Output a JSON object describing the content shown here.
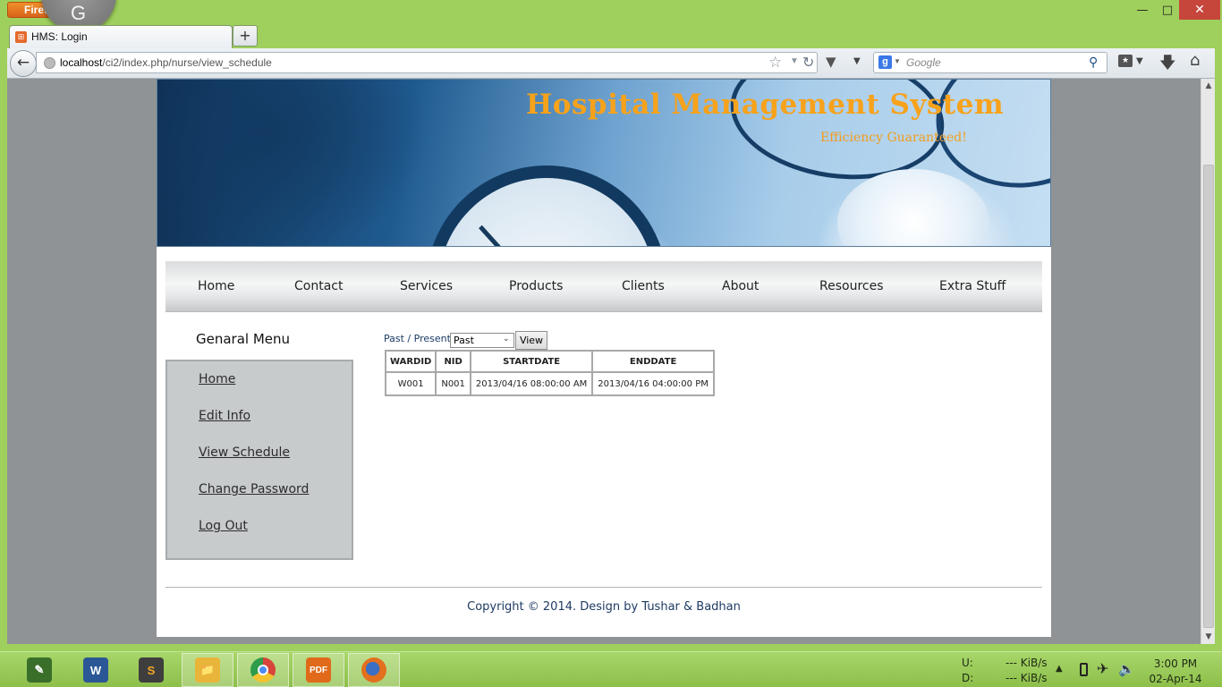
{
  "browser": {
    "menu_label": "Firefox",
    "tab_title": "HMS: Login",
    "url_host": "localhost",
    "url_path": "/ci2/index.php/nurse/view_schedule",
    "search_placeholder": "Google",
    "new_tab_label": "+"
  },
  "site": {
    "title": "Hospital Management System",
    "tagline": "Efficiency Guaranteed!"
  },
  "nav": {
    "items": [
      "Home",
      "Contact",
      "Services",
      "Products",
      "Clients",
      "About",
      "Resources",
      "Extra Stuff"
    ]
  },
  "sidebar": {
    "heading": "Genaral Menu",
    "links": [
      "Home",
      "Edit Info",
      "View Schedule",
      "Change Password",
      "Log Out"
    ]
  },
  "filter": {
    "label": "Past / Present :",
    "selected": "Past",
    "button": "View"
  },
  "schedule": {
    "columns": [
      "WARDID",
      "NID",
      "STARTDATE",
      "ENDDATE"
    ],
    "rows": [
      [
        "W001",
        "N001",
        "2013/04/16 08:00:00 AM",
        "2013/04/16 04:00:00 PM"
      ]
    ]
  },
  "footer": {
    "text": "Copyright © 2014. Design by Tushar & Badhan"
  },
  "taskbar": {
    "upload_label": "U:",
    "download_label": "D:",
    "upload_rate": "--- KiB/s",
    "download_rate": "--- KiB/s",
    "time": "3:00 PM",
    "date": "02-Apr-14",
    "apps": [
      {
        "name": "sigil",
        "icon": "book-edit-icon",
        "color": "#3a6f2a"
      },
      {
        "name": "word",
        "icon": "word-icon",
        "color": "#2b5797"
      },
      {
        "name": "sublime",
        "icon": "sublime-icon",
        "color": "#3e3e3e"
      },
      {
        "name": "explorer",
        "icon": "folder-icon",
        "color": "#e8b43a"
      },
      {
        "name": "chrome",
        "icon": "chrome-icon",
        "color": "#d8453a"
      },
      {
        "name": "foxit",
        "icon": "pdf-icon",
        "color": "#e06a1a"
      },
      {
        "name": "firefox",
        "icon": "firefox-icon",
        "color": "#e2701e"
      }
    ]
  }
}
